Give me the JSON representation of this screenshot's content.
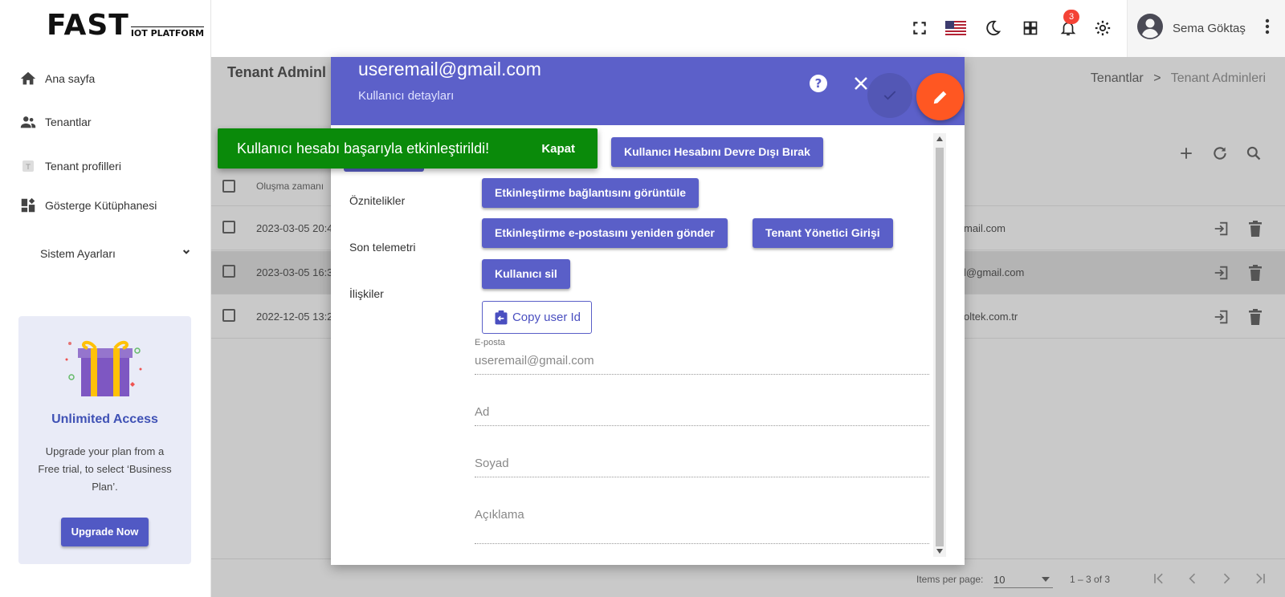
{
  "logo": {
    "main": "FAST",
    "sub": "IOT PLATFORM"
  },
  "sidebar": {
    "items": [
      {
        "label": "Ana sayfa",
        "icon": "home-icon"
      },
      {
        "label": "Tenantlar",
        "icon": "people-icon"
      },
      {
        "label": "Tenant profilleri",
        "icon": "tenant-profile-icon"
      },
      {
        "label": "Gösterge Kütüphanesi",
        "icon": "dashboard-library-icon"
      }
    ],
    "settings_label": "Sistem Ayarları"
  },
  "promo": {
    "title": "Unlimited Access",
    "desc": "Upgrade your plan from a Free trial, to select ‘Business Plan’.",
    "button": "Upgrade Now"
  },
  "topbar": {
    "notification_count": "3",
    "user_name": "Sema Göktaş"
  },
  "page": {
    "title": "Tenant Adminl",
    "breadcrumb": {
      "parent": "Tenantlar",
      "sep": ">",
      "current": "Tenant Adminleri"
    }
  },
  "table": {
    "header_created": "Oluşma zamanı",
    "rows": [
      {
        "created": "2023-03-05 20:4",
        "email": "mail.com"
      },
      {
        "created": "2023-03-05 16:3",
        "email": "l@gmail.com"
      },
      {
        "created": "2022-12-05 13:2",
        "email": "oltek.com.tr"
      }
    ]
  },
  "footer": {
    "items_per_page_label": "Items per page:",
    "items_per_page": "10",
    "range": "1 – 3 of 3"
  },
  "dialog": {
    "email": "useremail@gmail.com",
    "subtitle": "Kullanıcı detayları",
    "tabs": [
      "Öznitelikler",
      "Son telemetri",
      "İlişkiler"
    ],
    "buttons": {
      "disable": "Kullanıcı Hesabını Devre Dışı Bırak",
      "view_link": "Etkinleştirme bağlantısını görüntüle",
      "resend": "Etkinleştirme e-postasını yeniden gönder",
      "login_as": "Tenant Yönetici Girişi",
      "delete": "Kullanıcı sil",
      "copy_id": "Copy user Id"
    },
    "fields": {
      "email_label": "E-posta",
      "email_value": "useremail@gmail.com",
      "first_name": "Ad",
      "last_name": "Soyad",
      "description": "Açıklama"
    }
  },
  "snackbar": {
    "message": "Kullanıcı hesabı başarıyla etkinleştirildi!",
    "action": "Kapat"
  },
  "colors": {
    "primary": "#5c60c9",
    "accent": "#ff5722",
    "success": "#0a8a0a"
  }
}
